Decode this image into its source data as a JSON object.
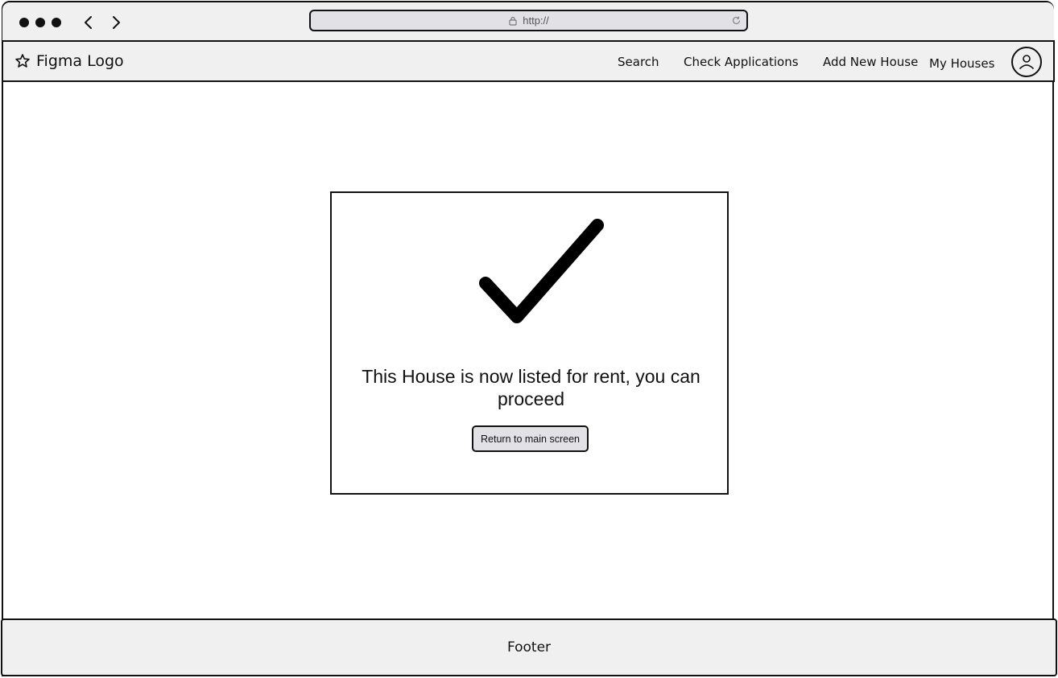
{
  "browser": {
    "url": "http://"
  },
  "navbar": {
    "brand": "Figma Logo",
    "links": [
      "Search",
      "Check Applications",
      "Add New House",
      "My Houses"
    ]
  },
  "confirmation": {
    "message": "This House is now listed for rent, you can proceed",
    "button_label": "Return to main screen"
  },
  "footer": {
    "label": "Footer"
  },
  "icons": {
    "brand": "star-icon",
    "profile": "user-icon",
    "status": "checkmark-icon",
    "back": "chevron-left-icon",
    "forward": "chevron-right-icon",
    "lock": "lock-icon",
    "reload": "reload-icon"
  }
}
